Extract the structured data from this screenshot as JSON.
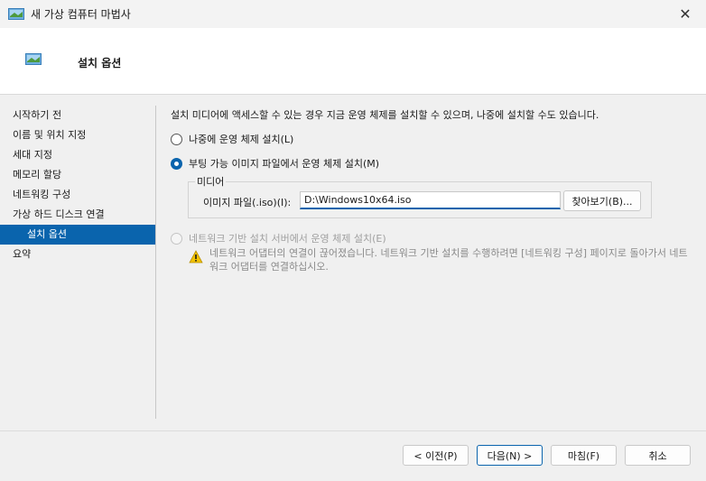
{
  "window": {
    "title": "새 가상 컴퓨터 마법사",
    "close_glyph": "✕"
  },
  "header": {
    "title": "설치 옵션"
  },
  "sidebar": {
    "items": [
      {
        "label": "시작하기 전"
      },
      {
        "label": "이름 및 위치 지정"
      },
      {
        "label": "세대 지정"
      },
      {
        "label": "메모리 할당"
      },
      {
        "label": "네트워킹 구성"
      },
      {
        "label": "가상 하드 디스크 연결"
      },
      {
        "label": "설치 옵션",
        "selected": true
      },
      {
        "label": "요약"
      }
    ]
  },
  "content": {
    "description": "설치 미디어에 액세스할 수 있는 경우 지금 운영 체제를 설치할 수 있으며, 나중에 설치할 수도 있습니다.",
    "options": {
      "later": "나중에 운영 체제 설치(L)",
      "bootable": "부팅 가능 이미지 파일에서 운영 체제 설치(M)",
      "network": "네트워크 기반 설치 서버에서 운영 체제 설치(E)"
    },
    "media": {
      "legend": "미디어",
      "iso_label": "이미지 파일(.iso)(I):",
      "iso_value": "D:\\Windows10x64.iso",
      "browse_label": "찾아보기(B)..."
    },
    "warning": "네트워크 어댑터의 연결이 끊어졌습니다. 네트워크 기반 설치를 수행하려면 [네트워킹 구성] 페이지로 돌아가서 네트워크 어댑터를 연결하십시오."
  },
  "footer": {
    "prev_label": "< 이전(P)",
    "next_label": "다음(N) >",
    "finish_label": "마침(F)",
    "cancel_label": "취소"
  },
  "colors": {
    "accent": "#0a64ad",
    "warning": "#f2c200"
  }
}
